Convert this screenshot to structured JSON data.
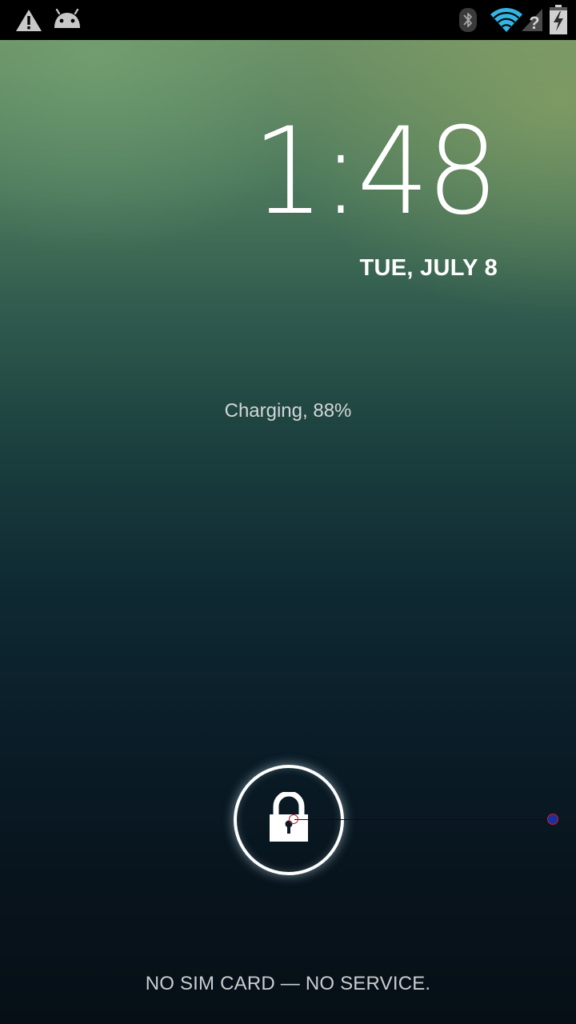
{
  "status_bar": {
    "left_icons": [
      "warning-icon",
      "android-debug-icon"
    ],
    "right_icons": [
      "bluetooth-icon",
      "wifi-icon",
      "no-signal-icon",
      "battery-charging-icon"
    ]
  },
  "lockscreen": {
    "time": "1:48",
    "date": "TUE, JULY 8",
    "charging": "Charging, 88%",
    "carrier": "NO SIM CARD — NO SERVICE.",
    "unlock_icon": "lock-icon"
  },
  "colors": {
    "wifi": "#33b5e5",
    "status_icons": "#c8c8c8",
    "touch_trace": "#c4202a"
  }
}
